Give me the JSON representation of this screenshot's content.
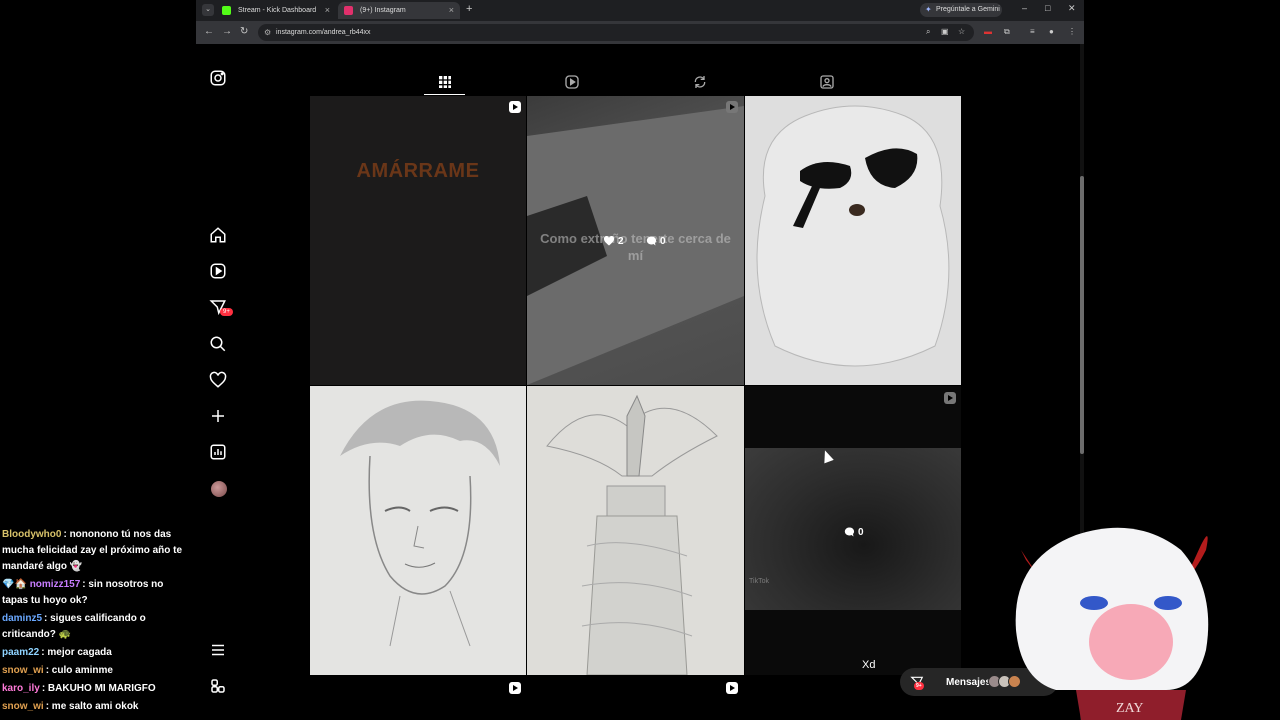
{
  "browser": {
    "tabs": [
      {
        "title": "Stream - Kick Dashboard",
        "favicon_color": "#53fc18"
      },
      {
        "title": "(9+) Instagram",
        "favicon_color": "#e1306c"
      }
    ],
    "new_tab": "+",
    "gemini_button": "Pregúntale a Gemini",
    "url": "instagram.com/andrea_rb44xx"
  },
  "instagram": {
    "sidebar": {
      "items": [
        {
          "name": "instagram-logo",
          "icon": "instagram-icon"
        },
        {
          "name": "home",
          "icon": "home-icon"
        },
        {
          "name": "reels",
          "icon": "reels-icon"
        },
        {
          "name": "messages",
          "icon": "direct-icon",
          "badge": "9+"
        },
        {
          "name": "search",
          "icon": "search-icon"
        },
        {
          "name": "notifications",
          "icon": "heart-icon"
        },
        {
          "name": "create",
          "icon": "plus-icon"
        },
        {
          "name": "dashboard",
          "icon": "dashboard-icon"
        },
        {
          "name": "profile",
          "icon": "avatar"
        },
        {
          "name": "more",
          "icon": "menu-icon"
        },
        {
          "name": "also-from-meta",
          "icon": "meta-icon"
        }
      ]
    },
    "profile_tabs": [
      "posts-grid-icon",
      "reels-icon",
      "reposts-icon",
      "tagged-icon"
    ],
    "posts": [
      {
        "id": 1,
        "overlay_text": "AMÁRRAME",
        "type": "reel"
      },
      {
        "id": 2,
        "overlay_text": "Como extraño tenerte cerca de mí",
        "likes": "2",
        "comments": "0",
        "type": "reel"
      },
      {
        "id": 3,
        "type": "image"
      },
      {
        "id": 4,
        "type": "image"
      },
      {
        "id": 5,
        "type": "image"
      },
      {
        "id": 6,
        "comments": "0",
        "watermark": "TikTok",
        "type": "reel"
      }
    ],
    "messages_button": "Mensajes",
    "messages_badge": "9+",
    "bottom_text": "Xd"
  },
  "chat": [
    {
      "user": "Bloodywho0",
      "color": "#d8c26a",
      "text": "nononono tú nos das mucha felicidad zay el próximo año te mandaré algo 👻"
    },
    {
      "user": "nomizz157",
      "color": "#c77dff",
      "text": "sin nosotros no tapas tu hoyo ok?",
      "prefix": "💎🏠"
    },
    {
      "user": "daminz5",
      "color": "#6aa8ff",
      "text": "sigues calificando o criticando? 🐢"
    },
    {
      "user": "paam22",
      "color": "#8fd3ff",
      "text": "mejor cagada"
    },
    {
      "user": "snow_wi",
      "color": "#e0a050",
      "text": "culo aminme"
    },
    {
      "user": "karo_ily",
      "color": "#ff7ad9",
      "text": "BAKUHO MI MARIGFO"
    },
    {
      "user": "snow_wi",
      "color": "#e0a050",
      "text": "me salto ami okok"
    }
  ],
  "overlay": {
    "vtuber_tag": "ZAY"
  }
}
